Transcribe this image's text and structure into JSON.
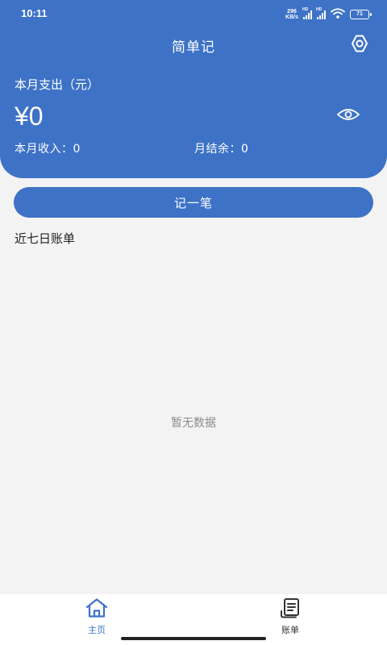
{
  "status_bar": {
    "time": "10:11",
    "net_speed_value": "296",
    "net_speed_unit": "KB/s",
    "sim1_tag": "HD",
    "sim2_tag": "HD",
    "battery_level": "71",
    "icons": [
      "signal-icon",
      "signal-icon",
      "wifi-icon",
      "battery-icon"
    ]
  },
  "header": {
    "title": "简单记",
    "settings_icon": "gear-icon",
    "expense_label": "本月支出（元）",
    "expense_amount": "¥0",
    "visibility_icon": "eye-icon",
    "income_text": "本月收入：0",
    "balance_text": "月结余：0"
  },
  "actions": {
    "record_button_label": "记一笔"
  },
  "recent": {
    "section_title": "近七日账单",
    "empty_text": "暂无数据"
  },
  "tab_bar": {
    "tabs": [
      {
        "label": "主页",
        "icon": "home-icon",
        "active": true
      },
      {
        "label": "账单",
        "icon": "bill-icon",
        "active": false
      }
    ]
  },
  "colors": {
    "primary": "#3d72c6",
    "background": "#f3f3f3",
    "muted_text": "#8a8a8a"
  }
}
